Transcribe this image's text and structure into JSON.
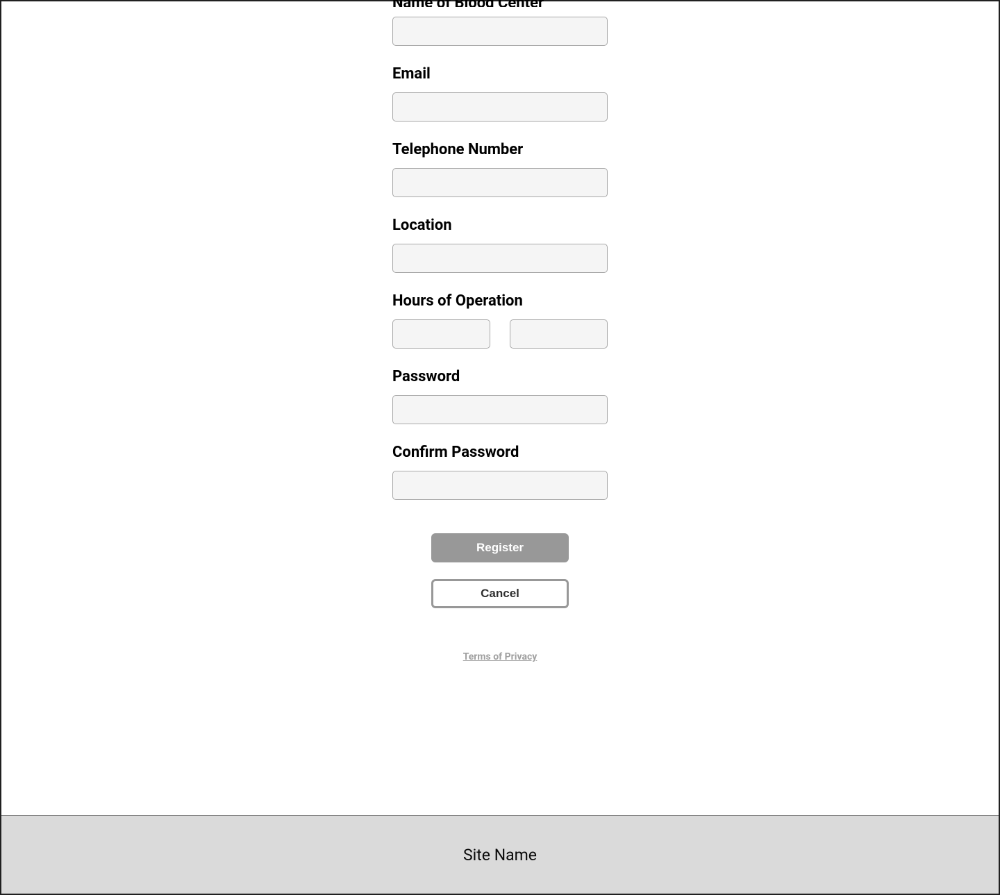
{
  "form": {
    "fields": {
      "bloodCenterName": {
        "label": "Name of Blood Center",
        "value": ""
      },
      "email": {
        "label": "Email",
        "value": ""
      },
      "telephone": {
        "label": "Telephone Number",
        "value": ""
      },
      "location": {
        "label": "Location",
        "value": ""
      },
      "hours": {
        "label": "Hours of Operation",
        "fromValue": "",
        "toValue": ""
      },
      "password": {
        "label": "Password",
        "value": ""
      },
      "confirmPassword": {
        "label": "Confirm Password",
        "value": ""
      }
    },
    "buttons": {
      "register": "Register",
      "cancel": "Cancel"
    },
    "termsLink": "Terms of Privacy"
  },
  "footer": {
    "siteName": "Site Name"
  }
}
